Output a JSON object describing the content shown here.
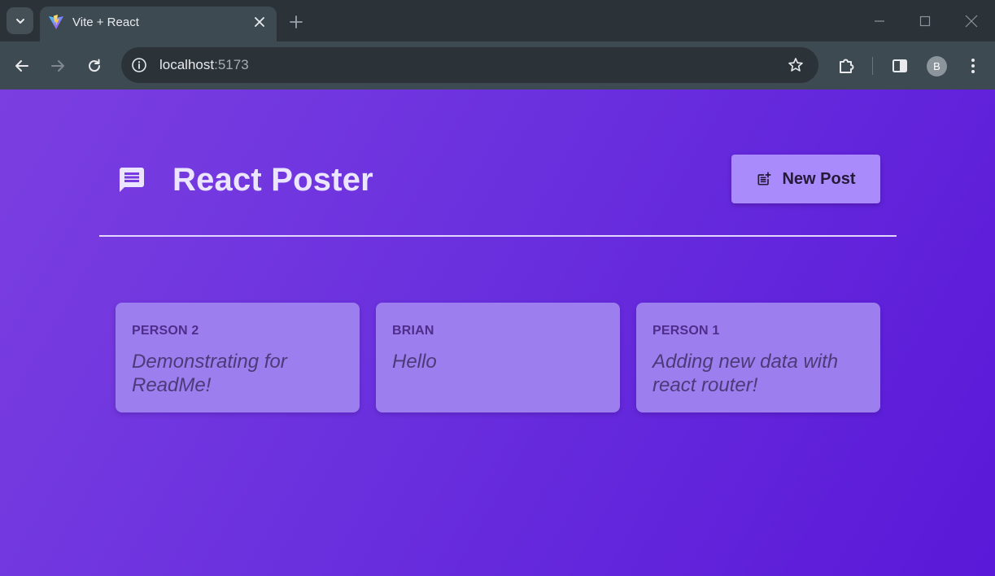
{
  "browser": {
    "tab": {
      "title": "Vite + React"
    },
    "address": {
      "host": "localhost",
      "port": ":5173"
    },
    "avatar_letter": "B"
  },
  "app": {
    "title": "React Poster",
    "new_post_label": "New Post",
    "posts": [
      {
        "author": "Person 2",
        "body": "Demonstrating for ReadMe!"
      },
      {
        "author": "Brian",
        "body": "Hello"
      },
      {
        "author": "Person 1",
        "body": "Adding new data with react router!"
      }
    ]
  },
  "colors": {
    "page_gradient_start": "#7b3fe0",
    "page_gradient_end": "#5a18d8",
    "button_bg": "#a98bfb",
    "card_bg": "#9d7eee"
  }
}
